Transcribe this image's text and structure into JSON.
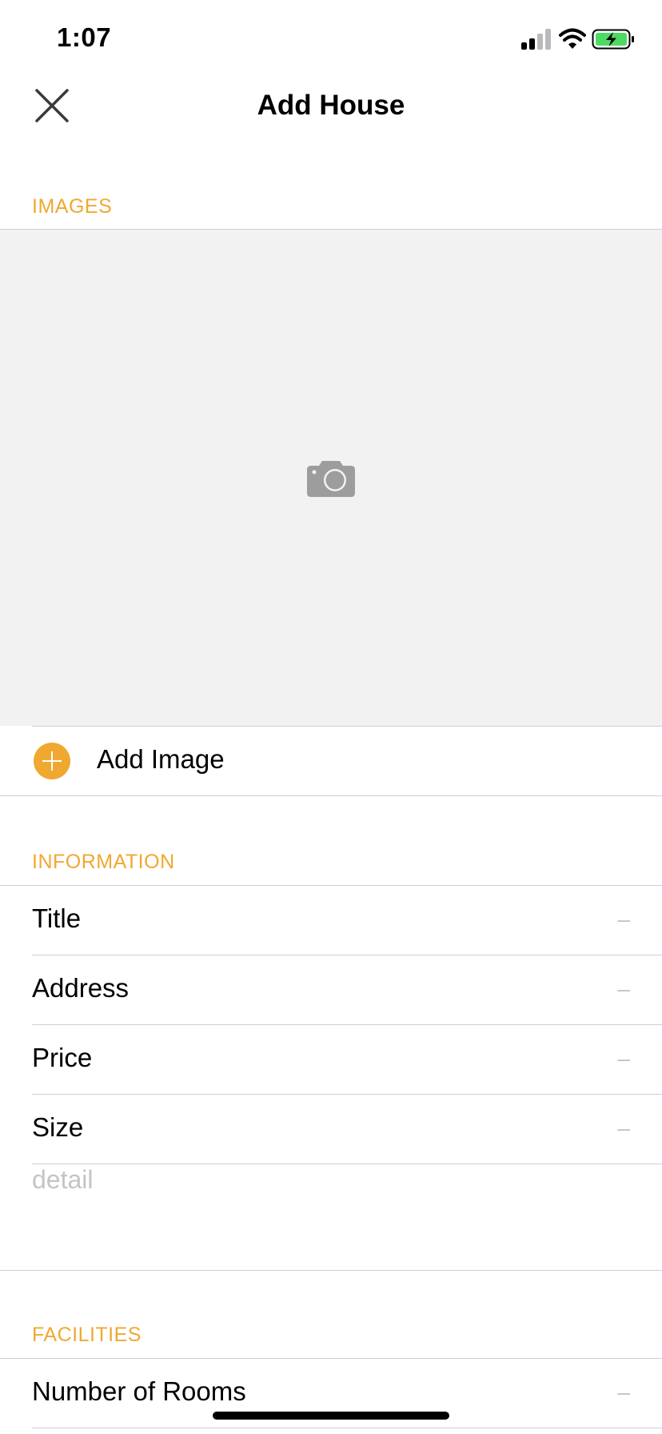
{
  "status": {
    "time": "1:07"
  },
  "nav": {
    "title": "Add House",
    "close_icon": "close-icon"
  },
  "sections": {
    "images": "IMAGES",
    "information": "INFORMATION",
    "facilities": "FACILITIES"
  },
  "images": {
    "placeholder_icon": "camera-icon",
    "add_label": "Add Image"
  },
  "information": {
    "rows": [
      {
        "label": "Title",
        "value": "–"
      },
      {
        "label": "Address",
        "value": "–"
      },
      {
        "label": "Price",
        "value": "–"
      },
      {
        "label": "Size",
        "value": "–"
      }
    ],
    "detail_placeholder": "detail"
  },
  "facilities": {
    "rows": [
      {
        "label": "Number of Rooms",
        "value": "–"
      }
    ]
  },
  "colors": {
    "accent": "#f0a830",
    "image_area_bg": "#f2f2f2",
    "separator": "#cfcfd3",
    "placeholder_text": "#c4c4c8",
    "battery_fill": "#4cd964"
  }
}
